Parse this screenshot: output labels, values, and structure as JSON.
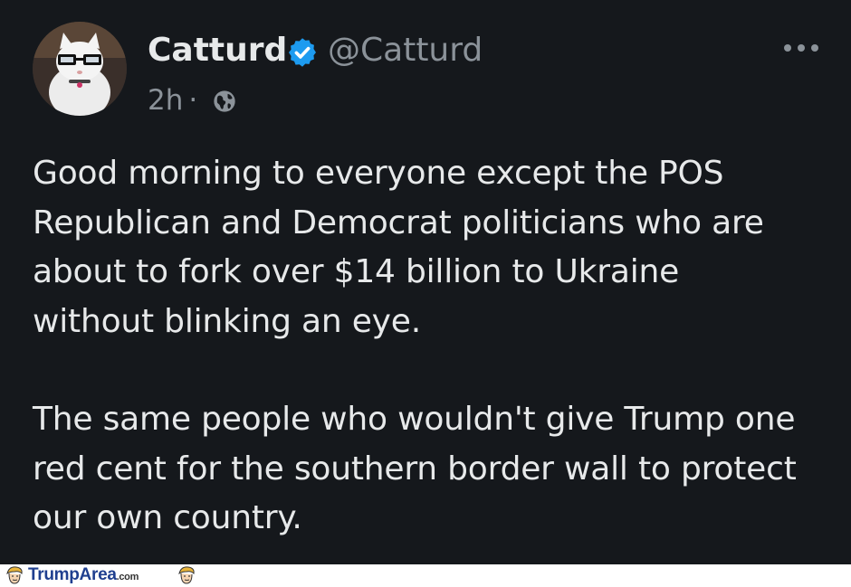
{
  "tweet": {
    "author_name": "Catturd",
    "handle": "@Catturd",
    "time": "2h",
    "separator": "·",
    "visibility_icon": "globe-icon",
    "verified_icon": "verified-badge-icon",
    "more_icon": "more-options-icon",
    "paragraphs": [
      "Good morning to everyone except the POS\nRepublican and Democrat politicians who are\nabout to fork over $14 billion to Ukraine\nwithout blinking an eye.",
      "The same people who wouldn't give Trump one\nred cent for the southern border wall to protect\nour own country."
    ]
  },
  "watermark": {
    "brand": "TrumpArea",
    "domain": ".com"
  },
  "colors": {
    "background": "#15181c",
    "text": "#e7e9ea",
    "secondary_text": "#8b9299",
    "verified_blue": "#1d9bf0",
    "watermark_blue": "#1f3f8f"
  }
}
